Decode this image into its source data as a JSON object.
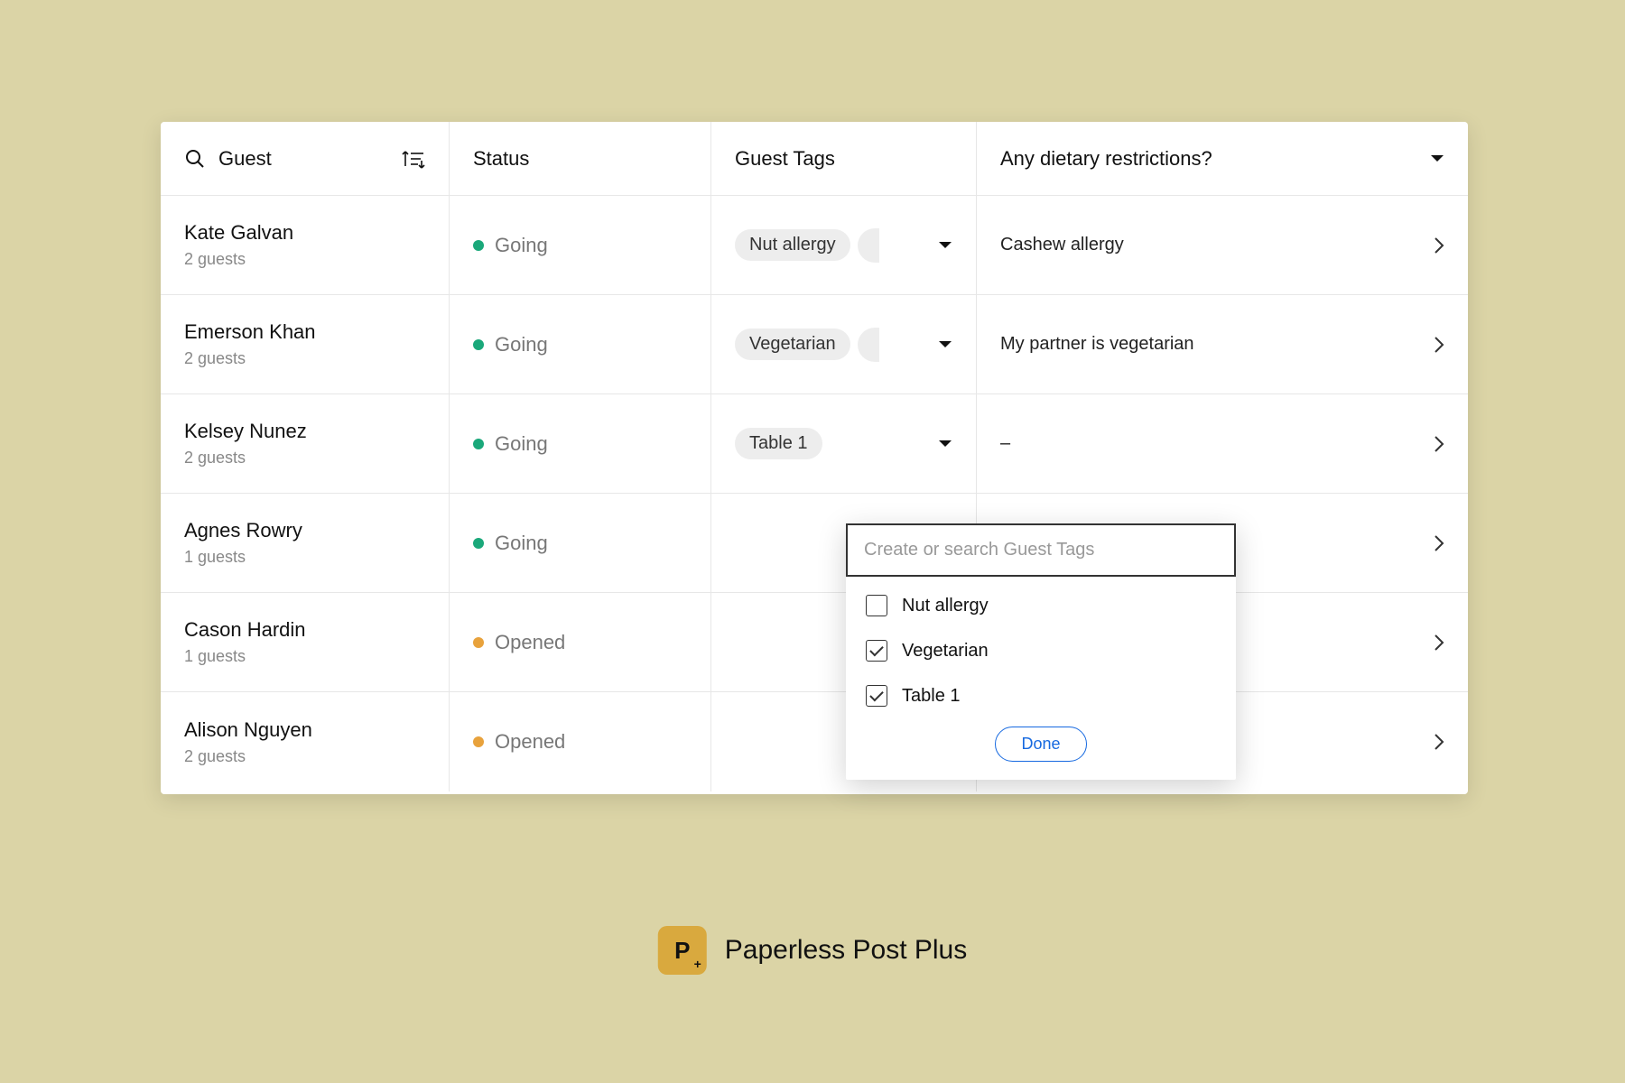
{
  "columns": {
    "guest": "Guest",
    "status": "Status",
    "tags": "Guest Tags",
    "diet": "Any dietary restrictions?"
  },
  "rows": [
    {
      "name": "Kate Galvan",
      "sub": "2 guests",
      "status": "Going",
      "statusColor": "green",
      "tags": [
        "Nut allergy"
      ],
      "tagsOverflow": true,
      "diet": "Cashew allergy"
    },
    {
      "name": "Emerson Khan",
      "sub": "2 guests",
      "status": "Going",
      "statusColor": "green",
      "tags": [
        "Vegetarian"
      ],
      "tagsOverflow": true,
      "diet": "My partner is vegetarian"
    },
    {
      "name": "Kelsey Nunez",
      "sub": "2 guests",
      "status": "Going",
      "statusColor": "green",
      "tags": [
        "Table 1"
      ],
      "tagsOverflow": false,
      "diet": "–"
    },
    {
      "name": "Agnes Rowry",
      "sub": "1 guests",
      "status": "Going",
      "statusColor": "green",
      "tags": [],
      "tagsOverflow": false,
      "diet": ""
    },
    {
      "name": "Cason Hardin",
      "sub": "1 guests",
      "status": "Opened",
      "statusColor": "orange",
      "tags": [],
      "tagsOverflow": false,
      "diet": ""
    },
    {
      "name": "Alison Nguyen",
      "sub": "2 guests",
      "status": "Opened",
      "statusColor": "orange",
      "tags": [],
      "tagsOverflow": false,
      "diet": ""
    }
  ],
  "popover": {
    "placeholder": "Create or search Guest Tags",
    "options": [
      {
        "label": "Nut allergy",
        "checked": false
      },
      {
        "label": "Vegetarian",
        "checked": true
      },
      {
        "label": "Table 1",
        "checked": true
      }
    ],
    "done": "Done"
  },
  "footer": {
    "badge": "P",
    "badgePlus": "+",
    "text": "Paperless Post Plus"
  }
}
